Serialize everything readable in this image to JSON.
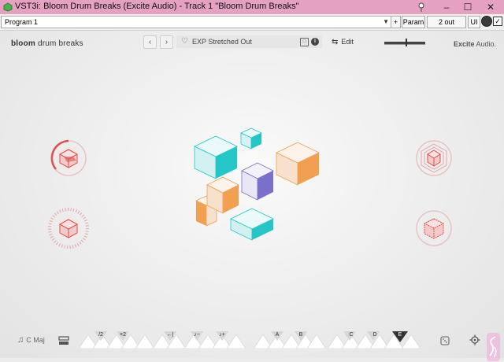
{
  "window": {
    "title": "VST3i: Bloom Drum Breaks (Excite Audio) - Track 1 \"Bloom Drum Breaks\"",
    "minimize": "–",
    "maximize": "☐",
    "close": "✕"
  },
  "host": {
    "program": "Program 1",
    "plus": "+",
    "param": "Param",
    "output": "2 out",
    "ui": "UI",
    "check": "✓"
  },
  "plugin": {
    "brand_bold": "bloom",
    "brand_rest": " drum breaks",
    "prev": "‹",
    "next": "›",
    "preset_name": "EXP Stretched Out",
    "info": "i",
    "edit_label": "Edit",
    "company_bold": "Excite",
    "company_rest": " Audio."
  },
  "bottom": {
    "key_label": "C Maj",
    "groups": [
      {
        "labels": [
          "/2",
          "×2"
        ]
      },
      {
        "labels": [
          "←|",
          "♪−",
          "♪+"
        ]
      },
      {
        "labels": [
          "A",
          "B"
        ]
      },
      {
        "labels": [
          "C",
          "D",
          "E"
        ]
      }
    ]
  },
  "colors": {
    "titlebar": "#e5a1c1",
    "knob_red": "#d9534f",
    "cube_teal": "#26c6c6",
    "cube_orange": "#f0a050",
    "cube_purple": "#7a6fc9"
  }
}
